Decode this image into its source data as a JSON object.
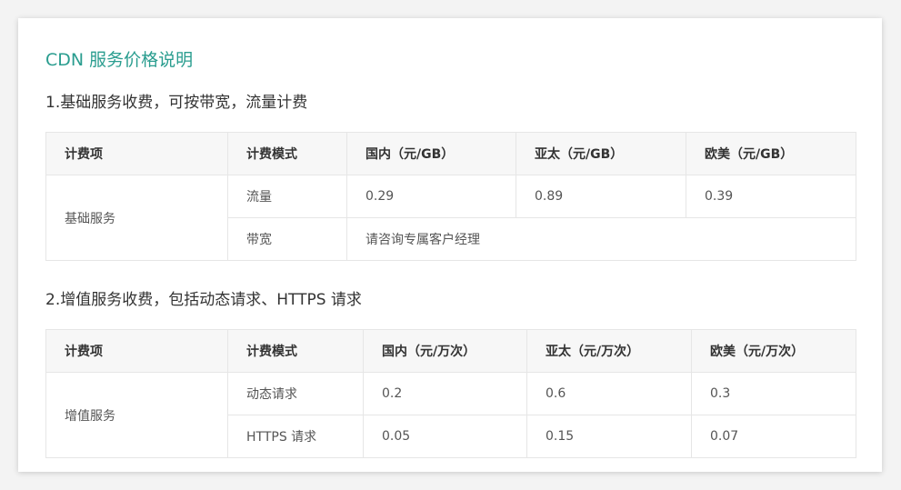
{
  "title": "CDN 服务价格说明",
  "section1": {
    "title": "1.基础服务收费，可按带宽，流量计费",
    "headers": [
      "计费项",
      "计费模式",
      "国内（元/GB）",
      "亚太（元/GB）",
      "欧美（元/GB）"
    ],
    "service": "基础服务",
    "rows": [
      {
        "mode": "流量",
        "domestic": "0.29",
        "apac": "0.89",
        "euus": "0.39"
      },
      {
        "mode": "带宽",
        "note": "请咨询专属客户经理"
      }
    ]
  },
  "section2": {
    "title": "2.增值服务收费，包括动态请求、HTTPS 请求",
    "headers": [
      "计费项",
      "计费模式",
      "国内（元/万次）",
      "亚太（元/万次）",
      "欧美（元/万次）"
    ],
    "service": "增值服务",
    "rows": [
      {
        "mode": "动态请求",
        "domestic": "0.2",
        "apac": "0.6",
        "euus": "0.3"
      },
      {
        "mode": "HTTPS 请求",
        "domestic": "0.05",
        "apac": "0.15",
        "euus": "0.07"
      }
    ]
  },
  "colors": {
    "accent": "#2a9d8f",
    "header_bg": "#f7f7f7",
    "border": "#e6e6e6"
  }
}
